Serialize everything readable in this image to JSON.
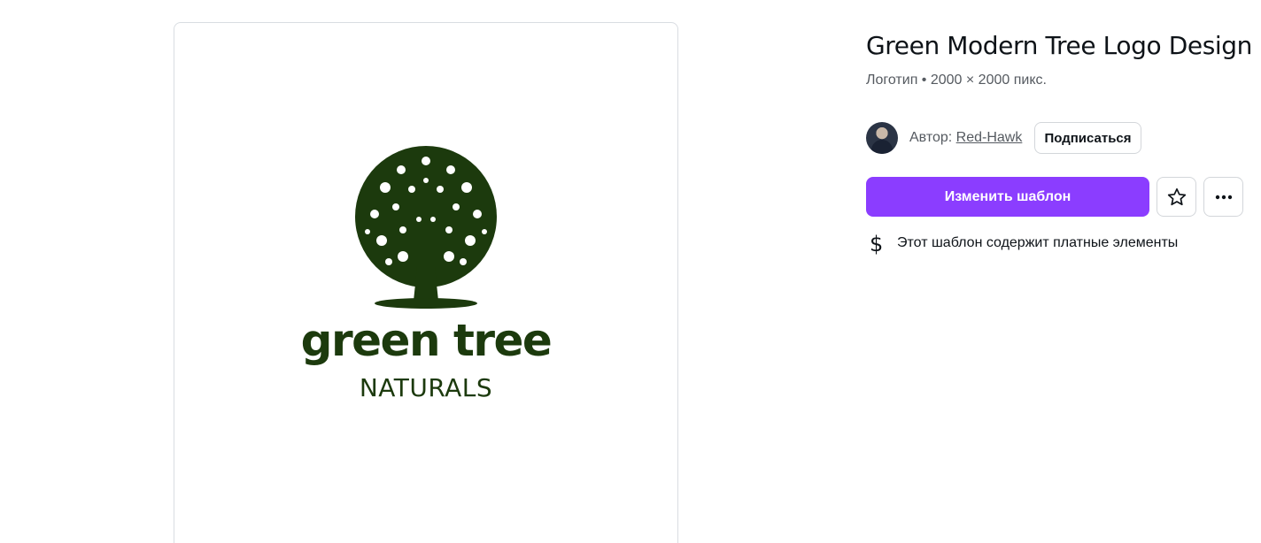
{
  "preview": {
    "logo_title": "green tree",
    "logo_subtitle": "NATURALS",
    "logo_color": "#1c3a0d"
  },
  "info": {
    "title": "Green Modern Tree Logo Design",
    "meta": "Логотип • 2000 × 2000 пикс.",
    "author_prefix": "Автор: ",
    "author_name": "Red-Hawk",
    "follow_label": "Подписаться",
    "primary_action_label": "Изменить шаблон",
    "star_icon": "star-icon",
    "more_icon": "more-icon",
    "paid_icon": "dollar-icon",
    "paid_symbol": "$",
    "paid_notice": "Этот шаблон содержит платные элементы"
  },
  "colors": {
    "accent": "#8b3dff",
    "text": "#0e1318",
    "muted": "#555a60"
  }
}
